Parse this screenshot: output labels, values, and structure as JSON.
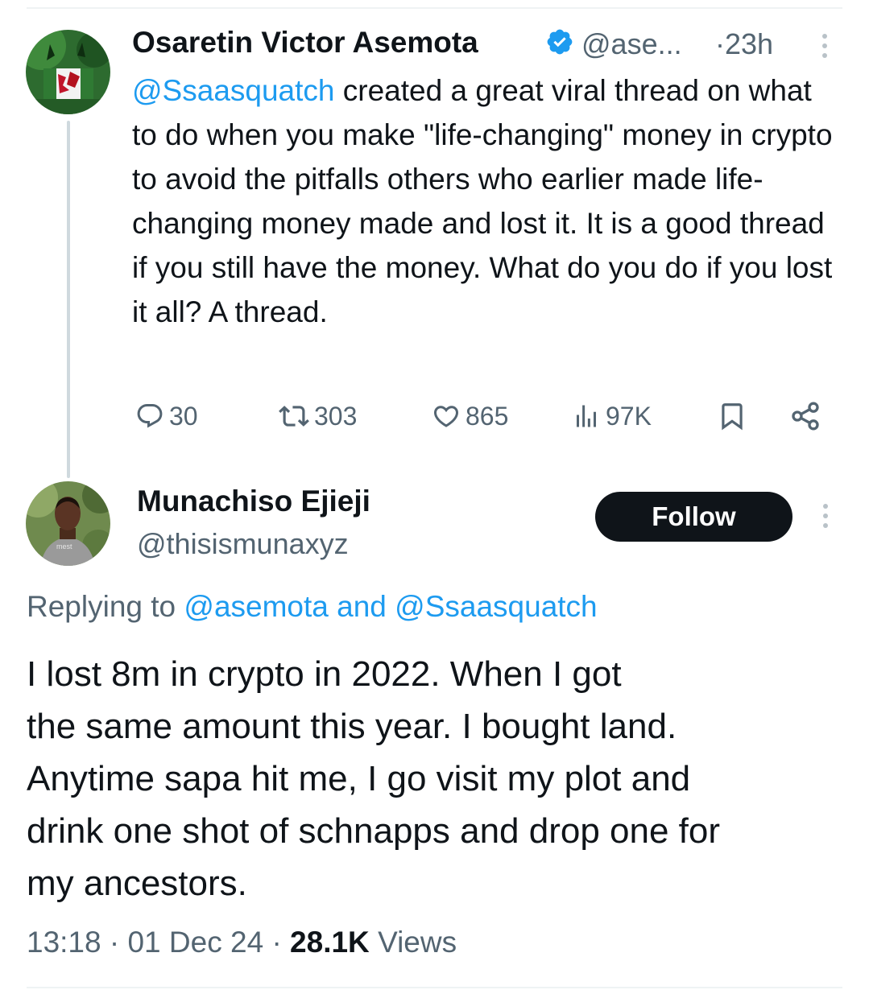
{
  "parent_tweet": {
    "author_name": "Osaretin Victor Asemota",
    "author_handle": "@ase...",
    "time_ago": "23h",
    "time_separator": "·",
    "mention": "@Ssaasquatch",
    "body": "created a great viral thread on what to do when you make \"life-changing\" money in crypto to avoid the pitfalls others who earlier made life-changing money made and lost it. It is a good thread if you still have the money. What do you do if you lost it all? A thread.",
    "stats": {
      "replies": "30",
      "reposts": "303",
      "likes": "865",
      "views": "97K"
    }
  },
  "reply_tweet": {
    "author_name": "Munachiso Ejieji",
    "author_handle": "@thisismunaxyz",
    "follow_label": "Follow",
    "replying_prefix": "Replying to",
    "replying_to": "@asemota and @Ssaasquatch",
    "body_lines": [
      "I lost 8m in crypto in 2022. When I got",
      "the same amount this year. I bought land.",
      "Anytime sapa hit me, I go visit my plot and",
      "drink one shot of schnapps and drop one for",
      "my ancestors."
    ],
    "time": "13:18",
    "date": "01 Dec 24",
    "separator": "·",
    "views_count": "28.1K",
    "views_label": "Views",
    "avatar_shirt_text": "mest"
  },
  "colors": {
    "text_primary": "#0f1419",
    "text_secondary": "#536471",
    "link": "#1d9bf0",
    "verified": "#1d9bf0",
    "follow_bg": "#0f1419"
  },
  "icons": [
    "verified-badge-icon",
    "more-dots-icon",
    "reply-icon",
    "repost-icon",
    "like-icon",
    "views-icon",
    "bookmark-icon",
    "share-icon"
  ]
}
